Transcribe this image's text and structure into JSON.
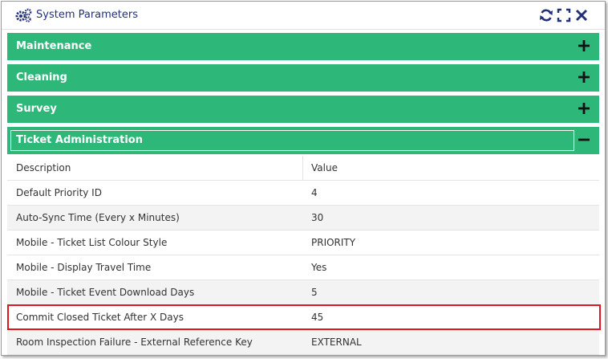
{
  "window": {
    "title": "System Parameters",
    "title_icon": "gears-icon",
    "controls": [
      "refresh-icon",
      "fullscreen-icon",
      "close-icon"
    ]
  },
  "sections": [
    {
      "label": "Maintenance",
      "state": "collapsed"
    },
    {
      "label": "Cleaning",
      "state": "collapsed"
    },
    {
      "label": "Survey",
      "state": "collapsed"
    },
    {
      "label": "Ticket Administration",
      "state": "expanded"
    }
  ],
  "table": {
    "headers": {
      "description": "Description",
      "value": "Value"
    },
    "rows": [
      {
        "description": "Default Priority ID",
        "value": "4"
      },
      {
        "description": "Auto-Sync Time (Every x Minutes)",
        "value": "30"
      },
      {
        "description": "Mobile - Ticket List Colour Style",
        "value": "PRIORITY"
      },
      {
        "description": "Mobile - Display Travel Time",
        "value": "Yes"
      },
      {
        "description": "Mobile - Ticket Event Download Days",
        "value": "5"
      },
      {
        "description": "Commit Closed Ticket After X Days",
        "value": "45",
        "highlighted": true
      },
      {
        "description": "Room Inspection Failure - External Reference Key",
        "value": "EXTERNAL"
      }
    ]
  },
  "colors": {
    "section_green": "#2db87a",
    "title_blue": "#22307a",
    "highlight_red": "#e2161c"
  }
}
